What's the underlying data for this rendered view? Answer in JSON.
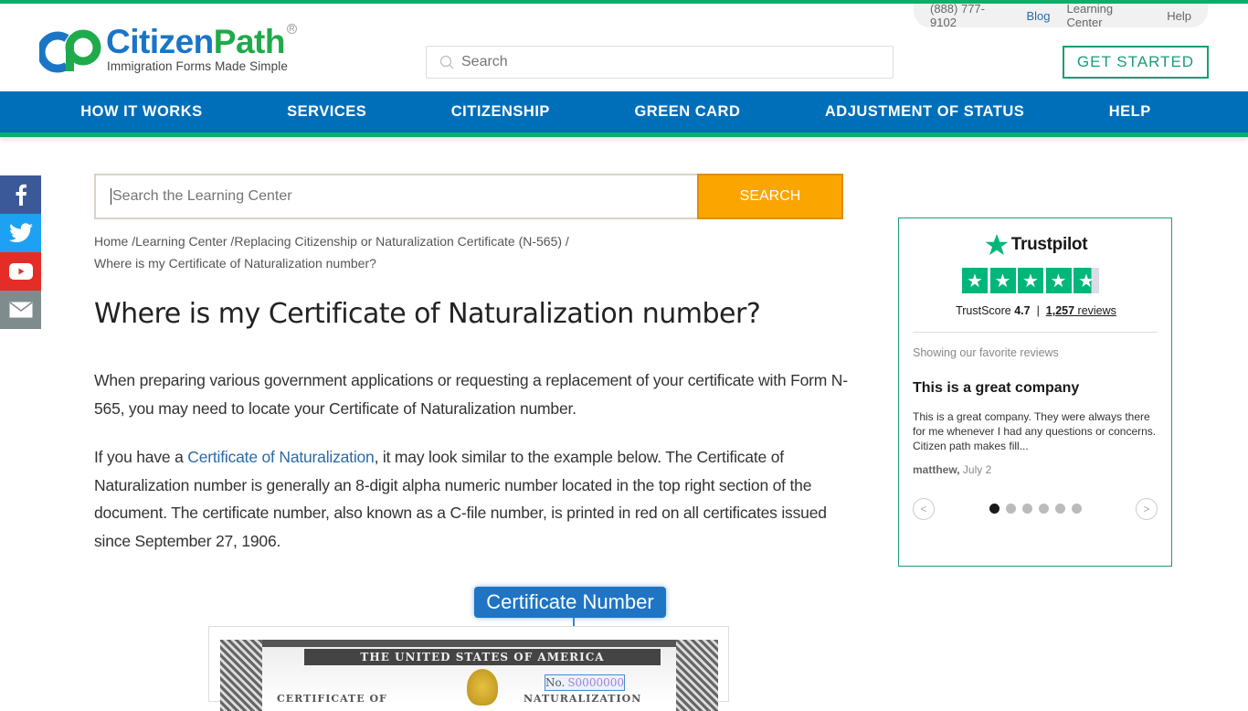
{
  "brand": {
    "name_part1": "Citizen",
    "name_part2": "Path",
    "tagline": "Immigration Forms Made Simple",
    "registered": "R",
    "colors": {
      "blue": "#1a75c7",
      "green": "#1faa4b",
      "nav_blue": "#006fba",
      "accent_green": "#0cae6a",
      "search_orange": "#fba600"
    }
  },
  "util_nav": {
    "phone": "(888) 777-9102",
    "items": [
      {
        "label": "Blog"
      },
      {
        "label": "Learning Center"
      },
      {
        "label": "Help"
      }
    ]
  },
  "header": {
    "search_placeholder": "Search",
    "get_started_label": "GET STARTED"
  },
  "main_nav": [
    {
      "label": "HOW IT WORKS"
    },
    {
      "label": "SERVICES"
    },
    {
      "label": "CITIZENSHIP"
    },
    {
      "label": "GREEN CARD"
    },
    {
      "label": "ADJUSTMENT OF STATUS"
    },
    {
      "label": "HELP"
    }
  ],
  "social": [
    {
      "icon": "facebook-icon",
      "color": "#3b5998"
    },
    {
      "icon": "twitter-icon",
      "color": "#1da1f2"
    },
    {
      "icon": "youtube-icon",
      "color": "#e52d27"
    },
    {
      "icon": "email-icon",
      "color": "#7f8c8d"
    }
  ],
  "learning_search": {
    "placeholder": "Search the Learning Center",
    "button_label": "SEARCH"
  },
  "breadcrumb": {
    "items": [
      {
        "label": "Home"
      },
      {
        "label": "Learning Center"
      },
      {
        "label": "Replacing Citizenship or Naturalization Certificate (N-565)"
      }
    ],
    "current": "Where is my Certificate of Naturalization number?"
  },
  "article": {
    "title": "Where is my Certificate of Naturalization number?",
    "para1": "When preparing various government applications or requesting a replacement of your certificate with Form N-565, you may need to locate your Certificate of Naturalization number.",
    "para2_before": "If you have a ",
    "para2_link": "Certificate of Naturalization",
    "para2_after": ", it may look similar to the example below. The Certificate of Naturalization number is generally an 8-digit alpha numeric number located in the top right section of the document. The certificate number, also known as a C-file number, is printed in red on all certificates issued since September 27, 1906.",
    "image": {
      "callout": "Certificate Number",
      "header_text": "THE UNITED STATES OF AMERICA",
      "no_label": "No.",
      "number": "S0000000",
      "left_title": "CERTIFICATE OF",
      "right_title": "NATURALIZATION"
    }
  },
  "trustpilot": {
    "brand": "Trustpilot",
    "rating": 4.7,
    "trustscore_label": "TrustScore",
    "trustscore": "4.7",
    "reviews_count": "1,257",
    "reviews_label": "reviews",
    "showing_label": "Showing our favorite reviews",
    "review": {
      "title": "This is a great company",
      "body": "This is a great company. They were always there for me whenever I had any questions or concerns. Citizen path makes fill...",
      "author": "matthew,",
      "date": "July 2"
    },
    "carousel": {
      "total": 6,
      "active_index": 0
    }
  }
}
